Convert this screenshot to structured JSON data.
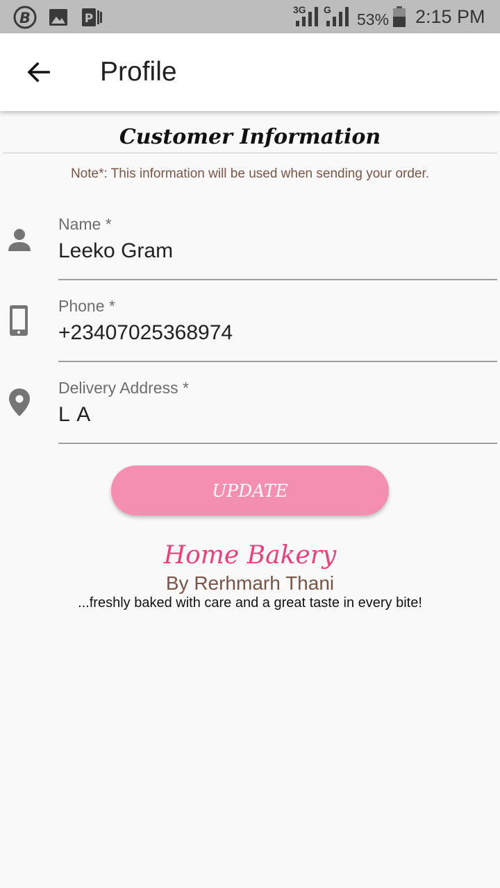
{
  "status_bar": {
    "network_3g": "3G",
    "network_g": "G",
    "battery_percent": "53%",
    "time": "2:15 PM",
    "icons": [
      "app-b-icon",
      "image-icon",
      "p-app-icon",
      "signal-icon",
      "signal-icon",
      "battery-icon"
    ]
  },
  "app_bar": {
    "back_icon": "arrow-back-icon",
    "title": "Profile"
  },
  "section": {
    "title": "Customer Information",
    "note": "Note*: This information will be used when sending your order."
  },
  "form": {
    "name": {
      "label": "Name *",
      "value": "Leeko Gram",
      "icon": "person-icon"
    },
    "phone": {
      "label": "Phone *",
      "value": "+23407025368974",
      "icon": "phone-icon"
    },
    "address": {
      "label": "Delivery Address *",
      "value": "L A",
      "icon": "location-pin-icon"
    }
  },
  "update_button": {
    "label": "UPDATE"
  },
  "footer": {
    "brand": "Home Bakery",
    "byline": "By Rerhmarh Thani",
    "tagline": "...freshly baked with care and a great taste in every bite!"
  },
  "colors": {
    "accent_pink": "#f48fb1",
    "brand_pink": "#ec407a",
    "brown_text": "#795548",
    "status_bar": "#bdbdbd"
  }
}
